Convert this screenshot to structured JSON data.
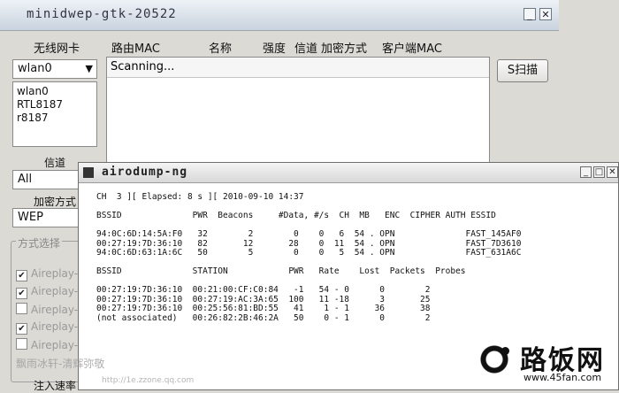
{
  "window1": {
    "title": "minidwep-gtk-20522",
    "headers": [
      "无线网卡",
      "路由MAC",
      "名称",
      "强度",
      "信道",
      "加密方式",
      "客户端MAC"
    ],
    "adapter_select": "wlan0",
    "adapter_list": [
      "wlan0 RTL8187",
      "r8187"
    ],
    "scan_status": "Scanning...",
    "scan_button": "S扫描",
    "channel_label": "信道",
    "channel_select": "All",
    "enc_label": "加密方式",
    "enc_select": "WEP",
    "mode_group_title": "方式选择",
    "modes": [
      {
        "label": "Aireplay-r",
        "checked": true
      },
      {
        "label": "Aireplay-r",
        "checked": true
      },
      {
        "label": "Aireplay-r",
        "checked": false
      },
      {
        "label": "Aireplay-r",
        "checked": true
      },
      {
        "label": "Aireplay-r",
        "checked": false
      }
    ],
    "inject_label": "注入速率"
  },
  "window2": {
    "title": "airodump-ng",
    "status_line": "CH  3 ][ Elapsed: 8 s ][ 2010-09-10 14:37",
    "ap_header": "BSSID              PWR  Beacons     #Data, #/s  CH  MB   ENC  CIPHER AUTH ESSID",
    "ap_rows": [
      "94:0C:6D:14:5A:F0   32        2        0    0   6  54 . OPN              FAST_145AF0",
      "00:27:19:7D:36:10   82       12       28    0  11  54 . OPN              FAST_7D3610",
      "94:0C:6D:63:1A:6C   50        5        0    0   5  54 . OPN              FAST_631A6C"
    ],
    "station_header": "BSSID              STATION            PWR   Rate    Lost  Packets  Probes",
    "station_rows": [
      "00:27:19:7D:36:10  00:21:00:CF:C0:84   -1   54 - 0      0        2",
      "00:27:19:7D:36:10  00:27:19:AC:3A:65  100   11 -18      3       25",
      "00:27:19:7D:36:10  00:25:56:81:BD:55   41    1 - 1     36       38",
      "(not associated)   00:26:82:2B:46:2A   50    0 - 1      0        2"
    ]
  },
  "watermark": {
    "left_text": "飘雨冰轩-清辉弥敬",
    "left_url": "http://1e.zzone.qq.com",
    "brand": "路饭网",
    "brand_url": "www.45fan.com"
  }
}
